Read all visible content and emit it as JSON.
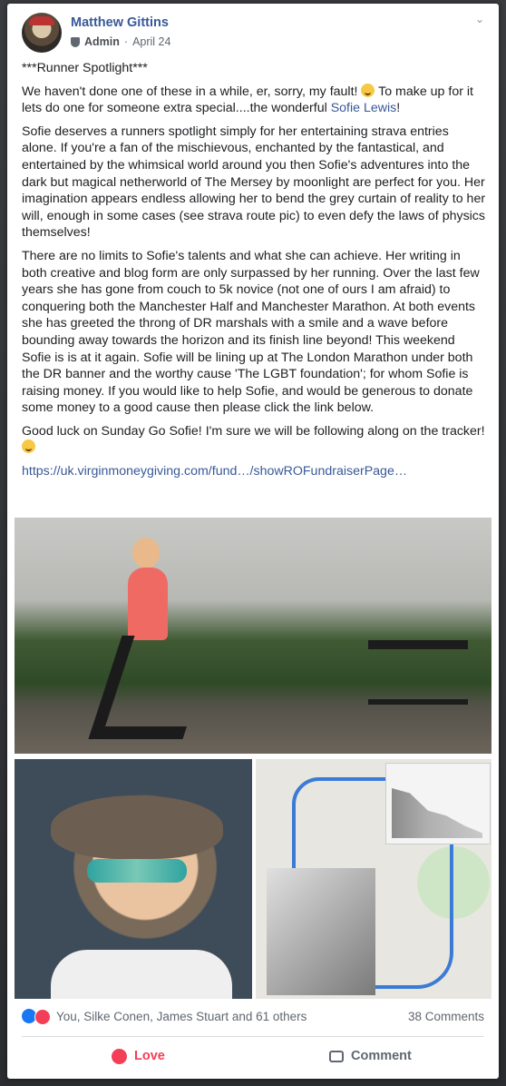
{
  "post": {
    "author": "Matthew Gittins",
    "role": "Admin",
    "separator": "·",
    "date": "April 24",
    "menu_icon": "chevron-down-icon"
  },
  "content": {
    "title": "***Runner Spotlight***",
    "p1_start": "We haven't done one of these in a while, er, sorry, my fault!",
    "p1_mid": " To make up for it lets do one for someone extra special....the wonderful ",
    "p1_link": "Sofie Lewis",
    "p1_end": "!",
    "p2": "Sofie deserves a runners spotlight simply for her entertaining strava entries alone. If you're a fan of the mischievous, enchanted by the fantastical, and entertained by the whimsical world around you then Sofie's adventures into the dark but magical netherworld of The Mersey by moonlight are perfect for you. Her imagination appears endless allowing her to bend the grey curtain of reality to her will, enough in some cases (see strava route pic) to even defy the laws of physics themselves!",
    "p3": "There are no limits to Sofie's talents and what she can achieve. Her writing in both creative and blog form are only surpassed by her running. Over the last few years she has gone from couch to 5k novice (not one of ours I am afraid) to conquering both the Manchester Half and Manchester Marathon. At both events she has greeted the throng of DR marshals with a smile and a wave before bounding away towards the horizon and its finish line beyond! This weekend Sofie is is at it again. Sofie will be lining up at The London Marathon under both the DR banner and the worthy cause 'The LGBT foundation'; for whom Sofie is raising money. If you would like to help Sofie, and would be generous to donate some money to a good cause then please click the link below.",
    "p4": "Good luck on Sunday Go Sofie! I'm sure we will be following along on the tracker!",
    "url": "https://uk.virginmoneygiving.com/fund…/showROFundraiserPage…"
  },
  "footer": {
    "reactions_text": "You, Silke Conen, James Stuart and 61 others",
    "comments_text": "38 Comments",
    "love_label": "Love",
    "comment_label": "Comment"
  },
  "colors": {
    "link": "#385898",
    "love": "#f33e58",
    "like": "#1877f2"
  }
}
